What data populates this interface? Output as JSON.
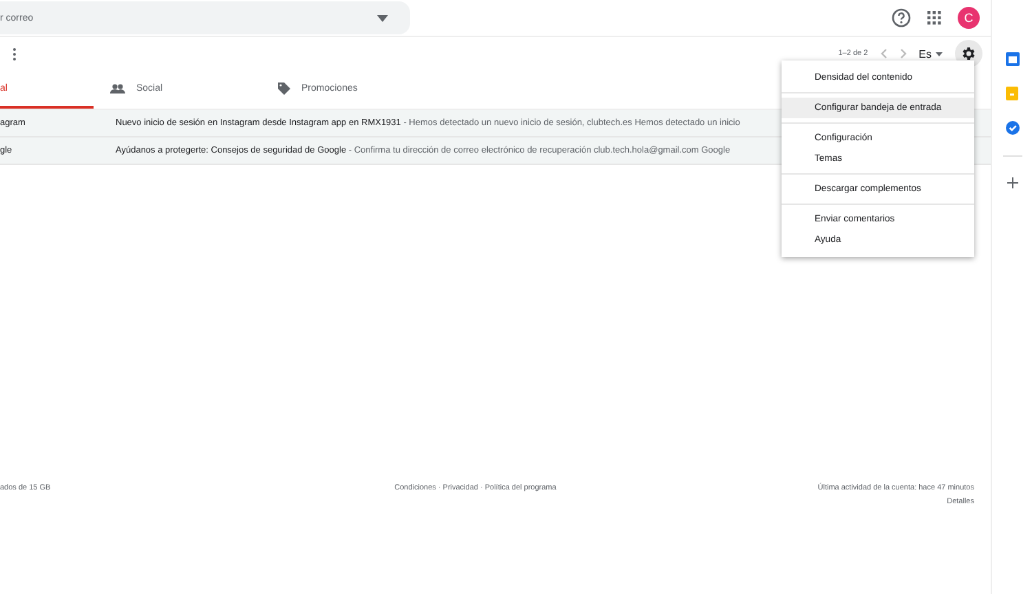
{
  "search": {
    "placeholder": "r correo"
  },
  "header": {
    "avatar": "C"
  },
  "toolbar": {
    "pagination": "1–2 de 2",
    "language": "Es"
  },
  "tabs": [
    {
      "label": "al",
      "selected": true,
      "kind": "primary"
    },
    {
      "label": "Social",
      "selected": false,
      "kind": "social"
    },
    {
      "label": "Promociones",
      "selected": false,
      "kind": "promotions"
    }
  ],
  "emails": [
    {
      "sender": "agram",
      "subject": "Nuevo inicio de sesión en Instagram desde Instagram app en RMX1931",
      "snippet": " - Hemos detectado un nuevo inicio de sesión, clubtech.es Hemos detectado un inicio"
    },
    {
      "sender": "gle",
      "subject": "Ayúdanos a protegerte: Consejos de seguridad de Google",
      "snippet": " - Confirma tu dirección de correo electrónico de recuperación club.tech.hola@gmail.com Google"
    }
  ],
  "menu": {
    "groups": [
      [
        {
          "label": "Densidad del contenido",
          "selected": false
        }
      ],
      [
        {
          "label": "Configurar bandeja de entrada",
          "selected": true
        }
      ],
      [
        {
          "label": "Configuración",
          "selected": false
        },
        {
          "label": "Temas",
          "selected": false
        }
      ],
      [
        {
          "label": "Descargar complementos",
          "selected": false
        }
      ],
      [
        {
          "label": "Enviar comentarios",
          "selected": false
        },
        {
          "label": "Ayuda",
          "selected": false
        }
      ]
    ]
  },
  "footer": {
    "storage": "ados de 15 GB",
    "links": "Condiciones · Privacidad · Política del programa",
    "activity": "Última actividad de la cuenta: hace 47 minutos",
    "details": "Detalles"
  }
}
